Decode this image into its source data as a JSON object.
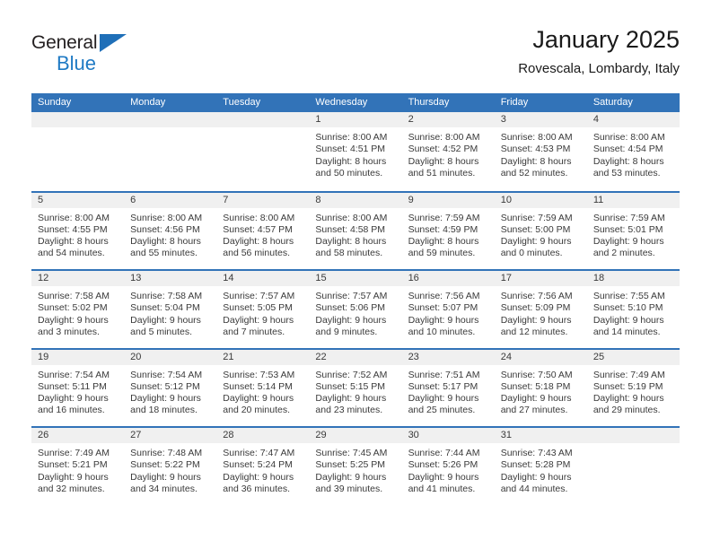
{
  "brand": {
    "name_top": "General",
    "name_bottom": "Blue",
    "triangle_color": "#1f6fb8",
    "blue_color": "#1f7ac4"
  },
  "header": {
    "title": "January 2025",
    "subtitle": "Rovescala, Lombardy, Italy"
  },
  "theme": {
    "header_blue": "#3273b8",
    "daynum_band": "#f0f0f0",
    "text": "#3a3a3a"
  },
  "weekdays": [
    "Sunday",
    "Monday",
    "Tuesday",
    "Wednesday",
    "Thursday",
    "Friday",
    "Saturday"
  ],
  "labels": {
    "sunrise_prefix": "Sunrise:",
    "sunset_prefix": "Sunset:",
    "daylight_prefix": "Daylight:"
  },
  "weeks": [
    [
      {
        "day": "",
        "lines": []
      },
      {
        "day": "",
        "lines": []
      },
      {
        "day": "",
        "lines": []
      },
      {
        "day": "1",
        "lines": [
          "Sunrise: 8:00 AM",
          "Sunset: 4:51 PM",
          "Daylight: 8 hours",
          "and 50 minutes."
        ]
      },
      {
        "day": "2",
        "lines": [
          "Sunrise: 8:00 AM",
          "Sunset: 4:52 PM",
          "Daylight: 8 hours",
          "and 51 minutes."
        ]
      },
      {
        "day": "3",
        "lines": [
          "Sunrise: 8:00 AM",
          "Sunset: 4:53 PM",
          "Daylight: 8 hours",
          "and 52 minutes."
        ]
      },
      {
        "day": "4",
        "lines": [
          "Sunrise: 8:00 AM",
          "Sunset: 4:54 PM",
          "Daylight: 8 hours",
          "and 53 minutes."
        ]
      }
    ],
    [
      {
        "day": "5",
        "lines": [
          "Sunrise: 8:00 AM",
          "Sunset: 4:55 PM",
          "Daylight: 8 hours",
          "and 54 minutes."
        ]
      },
      {
        "day": "6",
        "lines": [
          "Sunrise: 8:00 AM",
          "Sunset: 4:56 PM",
          "Daylight: 8 hours",
          "and 55 minutes."
        ]
      },
      {
        "day": "7",
        "lines": [
          "Sunrise: 8:00 AM",
          "Sunset: 4:57 PM",
          "Daylight: 8 hours",
          "and 56 minutes."
        ]
      },
      {
        "day": "8",
        "lines": [
          "Sunrise: 8:00 AM",
          "Sunset: 4:58 PM",
          "Daylight: 8 hours",
          "and 58 minutes."
        ]
      },
      {
        "day": "9",
        "lines": [
          "Sunrise: 7:59 AM",
          "Sunset: 4:59 PM",
          "Daylight: 8 hours",
          "and 59 minutes."
        ]
      },
      {
        "day": "10",
        "lines": [
          "Sunrise: 7:59 AM",
          "Sunset: 5:00 PM",
          "Daylight: 9 hours",
          "and 0 minutes."
        ]
      },
      {
        "day": "11",
        "lines": [
          "Sunrise: 7:59 AM",
          "Sunset: 5:01 PM",
          "Daylight: 9 hours",
          "and 2 minutes."
        ]
      }
    ],
    [
      {
        "day": "12",
        "lines": [
          "Sunrise: 7:58 AM",
          "Sunset: 5:02 PM",
          "Daylight: 9 hours",
          "and 3 minutes."
        ]
      },
      {
        "day": "13",
        "lines": [
          "Sunrise: 7:58 AM",
          "Sunset: 5:04 PM",
          "Daylight: 9 hours",
          "and 5 minutes."
        ]
      },
      {
        "day": "14",
        "lines": [
          "Sunrise: 7:57 AM",
          "Sunset: 5:05 PM",
          "Daylight: 9 hours",
          "and 7 minutes."
        ]
      },
      {
        "day": "15",
        "lines": [
          "Sunrise: 7:57 AM",
          "Sunset: 5:06 PM",
          "Daylight: 9 hours",
          "and 9 minutes."
        ]
      },
      {
        "day": "16",
        "lines": [
          "Sunrise: 7:56 AM",
          "Sunset: 5:07 PM",
          "Daylight: 9 hours",
          "and 10 minutes."
        ]
      },
      {
        "day": "17",
        "lines": [
          "Sunrise: 7:56 AM",
          "Sunset: 5:09 PM",
          "Daylight: 9 hours",
          "and 12 minutes."
        ]
      },
      {
        "day": "18",
        "lines": [
          "Sunrise: 7:55 AM",
          "Sunset: 5:10 PM",
          "Daylight: 9 hours",
          "and 14 minutes."
        ]
      }
    ],
    [
      {
        "day": "19",
        "lines": [
          "Sunrise: 7:54 AM",
          "Sunset: 5:11 PM",
          "Daylight: 9 hours",
          "and 16 minutes."
        ]
      },
      {
        "day": "20",
        "lines": [
          "Sunrise: 7:54 AM",
          "Sunset: 5:12 PM",
          "Daylight: 9 hours",
          "and 18 minutes."
        ]
      },
      {
        "day": "21",
        "lines": [
          "Sunrise: 7:53 AM",
          "Sunset: 5:14 PM",
          "Daylight: 9 hours",
          "and 20 minutes."
        ]
      },
      {
        "day": "22",
        "lines": [
          "Sunrise: 7:52 AM",
          "Sunset: 5:15 PM",
          "Daylight: 9 hours",
          "and 23 minutes."
        ]
      },
      {
        "day": "23",
        "lines": [
          "Sunrise: 7:51 AM",
          "Sunset: 5:17 PM",
          "Daylight: 9 hours",
          "and 25 minutes."
        ]
      },
      {
        "day": "24",
        "lines": [
          "Sunrise: 7:50 AM",
          "Sunset: 5:18 PM",
          "Daylight: 9 hours",
          "and 27 minutes."
        ]
      },
      {
        "day": "25",
        "lines": [
          "Sunrise: 7:49 AM",
          "Sunset: 5:19 PM",
          "Daylight: 9 hours",
          "and 29 minutes."
        ]
      }
    ],
    [
      {
        "day": "26",
        "lines": [
          "Sunrise: 7:49 AM",
          "Sunset: 5:21 PM",
          "Daylight: 9 hours",
          "and 32 minutes."
        ]
      },
      {
        "day": "27",
        "lines": [
          "Sunrise: 7:48 AM",
          "Sunset: 5:22 PM",
          "Daylight: 9 hours",
          "and 34 minutes."
        ]
      },
      {
        "day": "28",
        "lines": [
          "Sunrise: 7:47 AM",
          "Sunset: 5:24 PM",
          "Daylight: 9 hours",
          "and 36 minutes."
        ]
      },
      {
        "day": "29",
        "lines": [
          "Sunrise: 7:45 AM",
          "Sunset: 5:25 PM",
          "Daylight: 9 hours",
          "and 39 minutes."
        ]
      },
      {
        "day": "30",
        "lines": [
          "Sunrise: 7:44 AM",
          "Sunset: 5:26 PM",
          "Daylight: 9 hours",
          "and 41 minutes."
        ]
      },
      {
        "day": "31",
        "lines": [
          "Sunrise: 7:43 AM",
          "Sunset: 5:28 PM",
          "Daylight: 9 hours",
          "and 44 minutes."
        ]
      },
      {
        "day": "",
        "lines": []
      }
    ]
  ]
}
